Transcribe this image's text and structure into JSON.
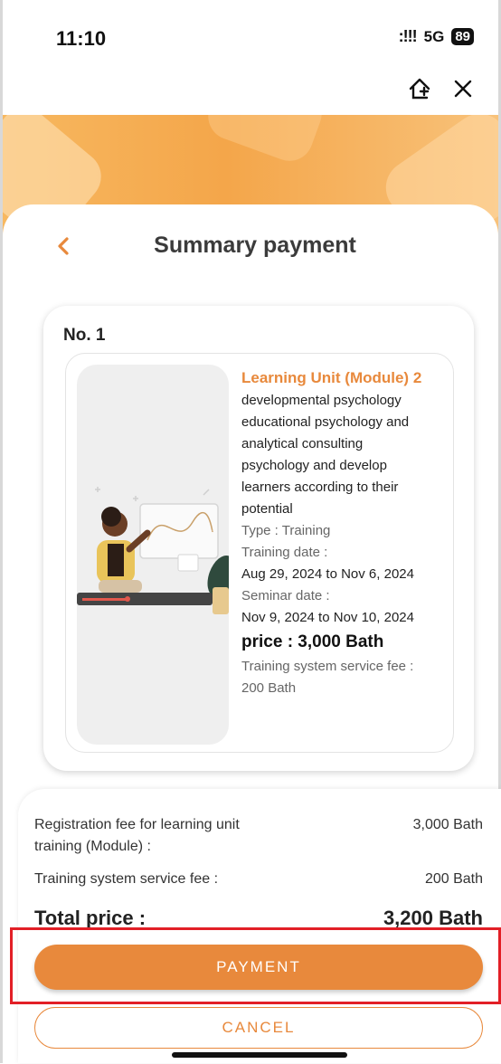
{
  "status_bar": {
    "time": "11:10",
    "signal": ":!!!",
    "network": "5G",
    "battery": "89"
  },
  "header": {
    "title": "Summary payment",
    "back_icon": "chevron-left-icon",
    "home_add_icon": "home-plus-icon",
    "close_icon": "close-icon"
  },
  "item": {
    "number": "No. 1",
    "title": "Learning Unit (Module) 2",
    "description_lines": [
      "developmental psychology",
      "educational psychology and",
      "analytical consulting",
      "psychology and develop",
      "learners according to their",
      "potential"
    ],
    "type": "Type : Training",
    "training_date_label": "Training date :",
    "training_date": "Aug 29, 2024 to Nov 6, 2024",
    "seminar_date_label": "Seminar date :",
    "seminar_date": "Nov 9, 2024 to Nov 10, 2024",
    "price": "price : 3,000 Bath",
    "service_fee_label": "Training system service fee :",
    "service_fee": "200 Bath"
  },
  "summary": {
    "registration_label_1": "Registration fee for learning unit",
    "registration_label_2": "training (Module) :",
    "registration_value": "3,000 Bath",
    "service_label": "Training system service fee :",
    "service_value": "200 Bath",
    "total_label": "Total price :",
    "total_value": "3,200 Bath"
  },
  "buttons": {
    "payment": "PAYMENT",
    "cancel": "CANCEL"
  },
  "colors": {
    "accent": "#e8893c",
    "highlight": "#e21f26"
  }
}
